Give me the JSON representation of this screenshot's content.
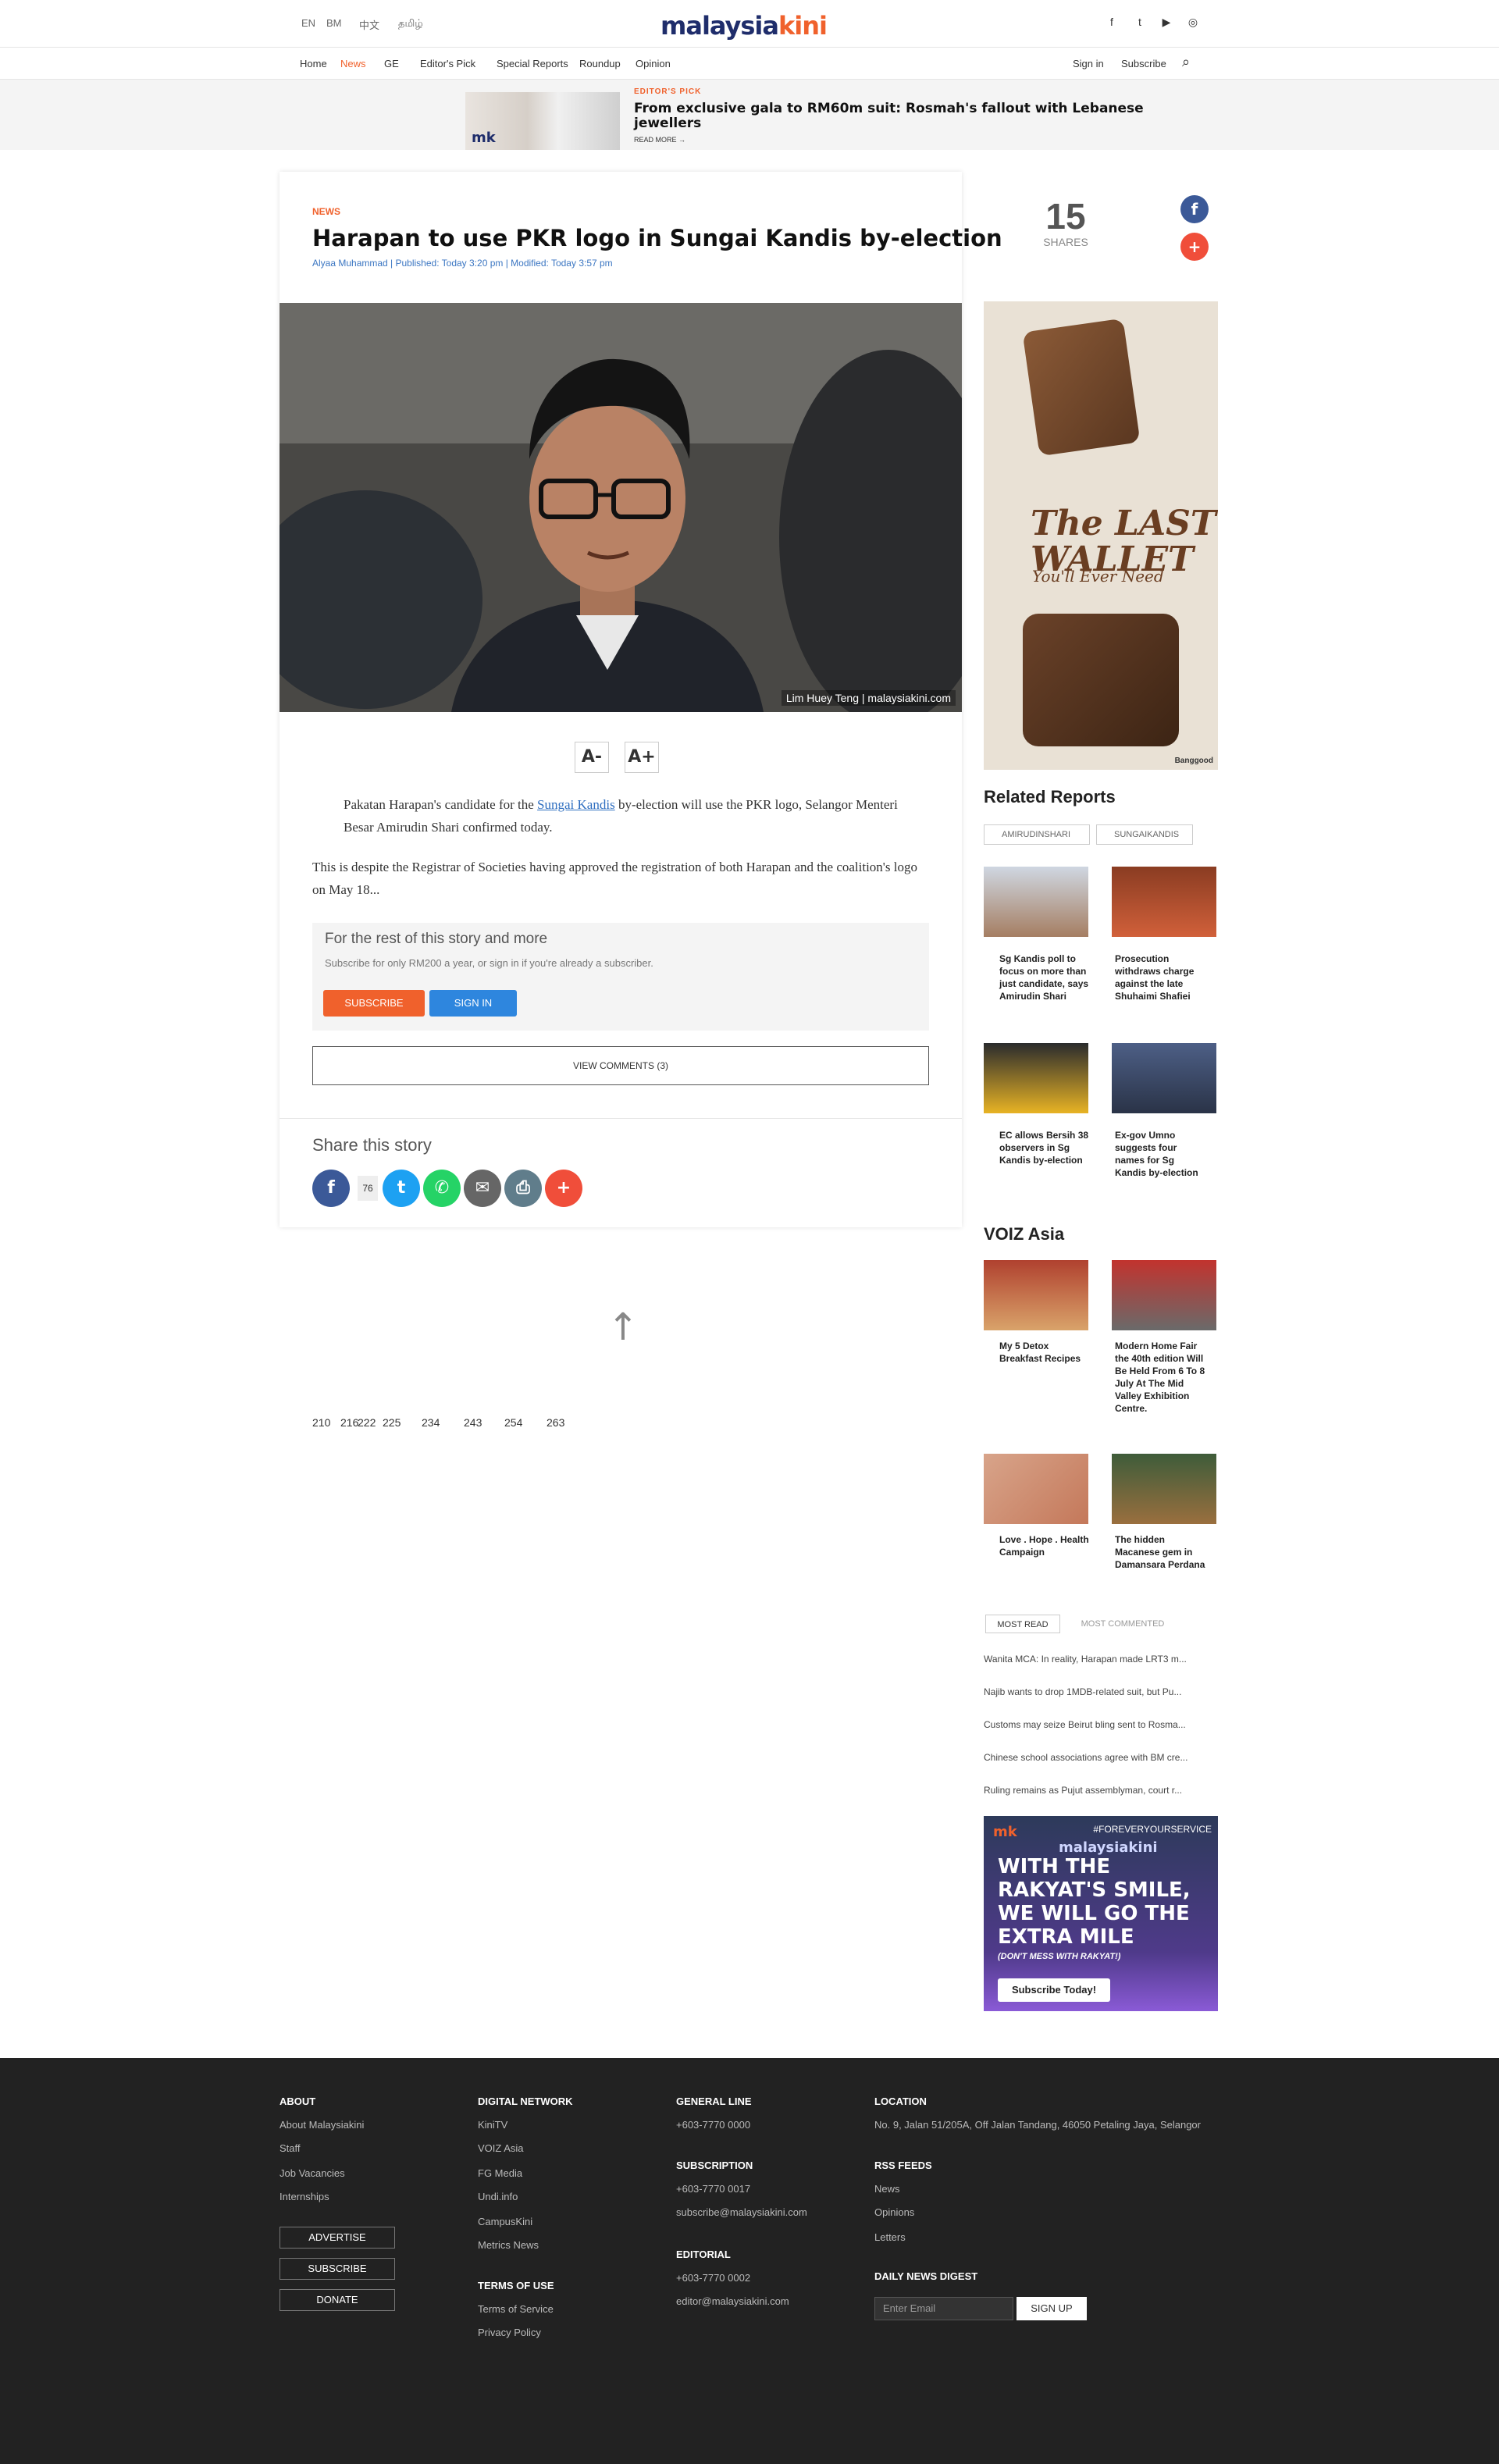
{
  "header": {
    "languages": [
      "EN",
      "BM",
      "中文",
      "தமிழ்"
    ],
    "logo_part1": "malaysia",
    "logo_part2": "kini",
    "social": [
      "f",
      "t",
      "▶",
      "◎"
    ]
  },
  "nav": {
    "items": [
      "Home",
      "News",
      "GE",
      "Editor's Pick",
      "Special Reports",
      "Roundup",
      "Opinion"
    ],
    "active_index": 1,
    "sign_in": "Sign in",
    "subscribe": "Subscribe"
  },
  "editors_pick": {
    "label": "EDITOR'S PICK",
    "title": "From exclusive gala to RM60m suit: Rosmah's fallout with Lebanese jewellers",
    "more": "READ MORE →"
  },
  "article": {
    "kicker": "NEWS",
    "headline": "Harapan to use PKR logo in Sungai Kandis by-election",
    "byline": "Alyaa Muhammad | Published: Today 3:20 pm | Modified: Today 3:57 pm",
    "shares_count": "15",
    "shares_label": "SHARES",
    "photo_credit": "Lim Huey Teng | malaysiakini.com",
    "font_minus": "A-",
    "font_plus": "A+",
    "para1_pre": "Pakatan Harapan's candidate for the ",
    "para1_link": "Sungai Kandis",
    "para1_post": " by-election will use the PKR logo, Selangor Menteri Besar Amirudin Shari confirmed today.",
    "para2": "This is despite the Registrar of Societies having approved the registration of both Harapan and the coalition's logo on May 18...",
    "paywall_title": "For the rest of this story and more",
    "paywall_sub": "Subscribe for only RM200 a year, or sign in if you're already a subscriber.",
    "subscribe_btn": "SUBSCRIBE",
    "signin_btn": "SIGN IN",
    "comments_btn": "VIEW COMMENTS (3)",
    "share_title": "Share this story",
    "share_count": "76"
  },
  "ad_wallet": {
    "line1": "The LAST",
    "line2": "WALLET",
    "line3": "You'll Ever Need",
    "brand": "Banggood"
  },
  "related": {
    "title": "Related Reports",
    "tags": [
      "AMIRUDINSHARI",
      "SUNGAIKANDIS"
    ],
    "items": [
      "Sg Kandis poll to focus on more than just candidate, says Amirudin Shari",
      "Prosecution withdraws charge against the late Shuhaimi Shafiei",
      "EC allows Bersih 38 observers in Sg Kandis by-election",
      "Ex-gov Umno suggests four names for Sg Kandis by-election"
    ]
  },
  "voiz": {
    "title": "VOIZ Asia",
    "items": [
      "My 5 Detox Breakfast Recipes",
      "Modern Home Fair the 40th edition Will Be Held From 6 To 8 July At The Mid Valley Exhibition Centre.",
      "Love . Hope . Health Campaign",
      "The hidden Macanese gem in Damansara Perdana"
    ]
  },
  "most": {
    "tab_read": "MOST READ",
    "tab_commented": "MOST COMMENTED",
    "items": [
      "Wanita MCA: In reality, Harapan made LRT3 m...",
      "Najib wants to drop 1MDB-related suit, but Pu...",
      "Customs may seize Beirut bling sent to Rosma...",
      "Chinese school associations agree with BM cre...",
      "Ruling remains as Pujut assemblyman, court r..."
    ]
  },
  "ad_mk": {
    "tagline": "#FOREVERYOURSERVICE",
    "brand": "malaysiakini",
    "headline": "WITH THE RAKYAT'S SMILE, WE WILL GO THE EXTRA MILE",
    "sub": "(DON'T MESS WITH RAKYAT!)",
    "cta": "Subscribe Today!"
  },
  "pagination": [
    "210",
    "216",
    "222",
    "225",
    "234",
    "243",
    "254",
    "263"
  ],
  "footer": {
    "about": {
      "heading": "ABOUT",
      "links": [
        "About Malaysiakini",
        "Staff",
        "Job Vacancies",
        "Internships"
      ]
    },
    "buttons": [
      "ADVERTISE",
      "SUBSCRIBE",
      "DONATE"
    ],
    "network": {
      "heading": "DIGITAL NETWORK",
      "links": [
        "KiniTV",
        "VOIZ Asia",
        "FG Media",
        "Undi.info",
        "CampusKini",
        "Metrics News"
      ]
    },
    "terms": {
      "heading": "TERMS OF USE",
      "links": [
        "Terms of Service",
        "Privacy Policy"
      ]
    },
    "general": {
      "heading": "GENERAL LINE",
      "value": "+603-7770 0000"
    },
    "subscription": {
      "heading": "SUBSCRIPTION",
      "phone": "+603-7770 0017",
      "email": "subscribe@malaysiakini.com"
    },
    "editorial": {
      "heading": "EDITORIAL",
      "phone": "+603-7770 0002",
      "email": "editor@malaysiakini.com"
    },
    "location": {
      "heading": "LOCATION",
      "address": "No. 9, Jalan 51/205A, Off Jalan Tandang, 46050 Petaling Jaya, Selangor"
    },
    "rss": {
      "heading": "RSS FEEDS",
      "links": [
        "News",
        "Opinions",
        "Letters"
      ]
    },
    "digest": {
      "heading": "DAILY NEWS DIGEST",
      "placeholder": "Enter Email",
      "button": "SIGN UP"
    }
  },
  "colors": {
    "brand_navy": "#1f2d6b",
    "brand_orange": "#f0612c",
    "link_blue": "#2e6ec0",
    "footer_bg": "#222222"
  }
}
